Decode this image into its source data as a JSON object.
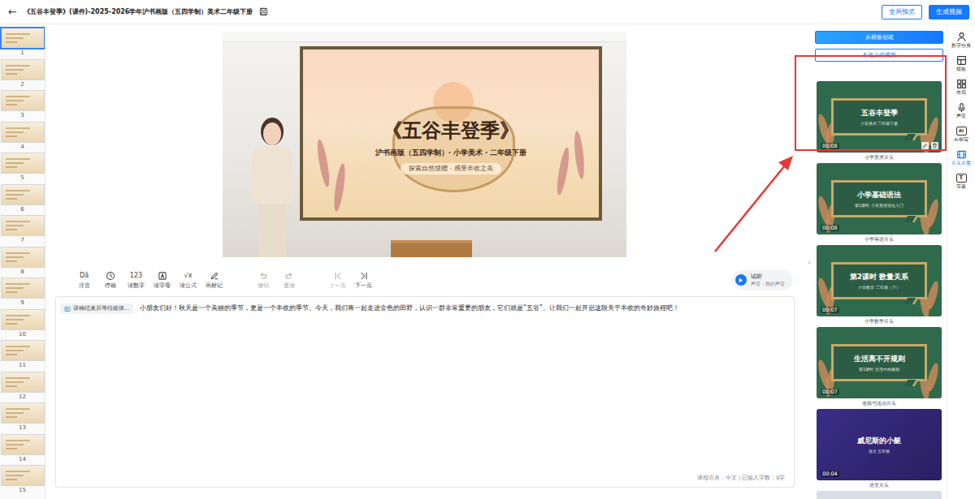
{
  "header": {
    "back": "←",
    "title": "《五谷丰登季》(课件)-2025-2026学年沪书画版（五四学制）美术二年级下册",
    "buttons": [
      {
        "label": "全局预览",
        "kind": "outline"
      },
      {
        "label": "生成视频",
        "kind": "primary"
      }
    ]
  },
  "slides": [
    {
      "number": "1",
      "selected": true
    },
    {
      "number": "2",
      "selected": false
    },
    {
      "number": "3",
      "selected": false
    },
    {
      "number": "4",
      "selected": false
    },
    {
      "number": "5",
      "selected": false
    },
    {
      "number": "6",
      "selected": false
    },
    {
      "number": "7",
      "selected": false
    },
    {
      "number": "8",
      "selected": false
    },
    {
      "number": "9",
      "selected": false
    },
    {
      "number": "10",
      "selected": false
    },
    {
      "number": "11",
      "selected": false
    },
    {
      "number": "12",
      "selected": false
    },
    {
      "number": "13",
      "selected": false
    },
    {
      "number": "14",
      "selected": false
    },
    {
      "number": "15",
      "selected": false
    }
  ],
  "preview": {
    "title": "《五谷丰登季》",
    "subtitle": "沪书画版（五四学制）· 小学美术 · 二年级下册",
    "tagline": "探索自然馈赠 · 感受丰收之美"
  },
  "toolbar": {
    "tools": [
      {
        "label": "注音",
        "icon": "Dā",
        "disabled": false
      },
      {
        "label": "停顿",
        "disabled": false
      },
      {
        "label": "读数字",
        "icon": "123",
        "disabled": false
      },
      {
        "label": "读字母",
        "disabled": false
      },
      {
        "label": "读公式",
        "icon": "√x",
        "disabled": false
      },
      {
        "label": "画标记",
        "disabled": false
      },
      {
        "label": "撤销",
        "disabled": true
      },
      {
        "label": "重做",
        "disabled": true
      },
      {
        "label": "上一页",
        "disabled": true
      },
      {
        "label": "下一页",
        "disabled": false
      }
    ],
    "listen": {
      "label": "试听",
      "voice": "声音：我的声音"
    }
  },
  "script": {
    "chip": "讲稿结束后等待媒体...",
    "text": "小朋友们好！秋天是一个美丽的季节，更是一个丰收的季节。今天，我们将一起走进金色的田野，认识一群非常重要的朋友，它们就是“五谷”。让我们一起开启这段关于丰收的奇妙旅程吧！",
    "footer": "课程语言：中文 | 已输入字数：0字"
  },
  "panel": {
    "collapse": "›",
    "create": "从模板创建",
    "upload": "本地上传视频",
    "cards": [
      {
        "title": "五谷丰登季",
        "sub": "小学美术 二年级下册",
        "duration": "00:08",
        "label": "小学美术片头",
        "kind": "green",
        "selected": true
      },
      {
        "title": "小学基础语法",
        "sub": "第1课时 小学英语语法入门",
        "duration": "00:08",
        "label": "小学英语片头",
        "kind": "green",
        "selected": false
      },
      {
        "title": "第2课时 数量关系",
        "sub": "小学数学 二年级（下）",
        "duration": "00:07",
        "label": "小学数学片头",
        "kind": "green",
        "selected": false
      },
      {
        "title": "生活离不开规则",
        "sub": "第1课时 生活中的规则",
        "duration": "00:07",
        "label": "道德与法治片头",
        "kind": "green",
        "selected": false
      },
      {
        "title": "威尼斯的小艇",
        "sub": "语文 五年级",
        "duration": "00:04",
        "label": "语文片头",
        "kind": "purple",
        "selected": false
      }
    ]
  },
  "rail": [
    {
      "label": "数字分身",
      "selected": false
    },
    {
      "label": "模板",
      "selected": false
    },
    {
      "label": "布局",
      "selected": false
    },
    {
      "label": "声音",
      "selected": false
    },
    {
      "label": "AI帮写",
      "icon": "AI",
      "selected": false
    },
    {
      "label": "片头片尾",
      "selected": true
    },
    {
      "label": "字幕",
      "icon": "T",
      "selected": false
    }
  ]
}
